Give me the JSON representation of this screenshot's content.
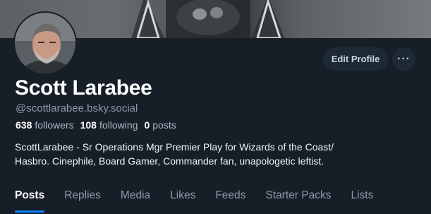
{
  "profile": {
    "display_name": "Scott Larabee",
    "handle": "@scottlarabee.bsky.social",
    "followers_count": "638",
    "followers_label": "followers",
    "following_count": "108",
    "following_label": "following",
    "posts_count": "0",
    "posts_label": "posts",
    "bio_line1": "ScottLarabee - Sr Operations Mgr Premier Play for Wizards of the Coast/",
    "bio_line2": "Hasbro. Cinephile, Board Gamer, Commander fan, unapologetic leftist."
  },
  "actions": {
    "edit_label": "Edit Profile",
    "more_label": "···"
  },
  "tabs": [
    {
      "label": "Posts",
      "active": true
    },
    {
      "label": "Replies",
      "active": false
    },
    {
      "label": "Media",
      "active": false
    },
    {
      "label": "Likes",
      "active": false
    },
    {
      "label": "Feeds",
      "active": false
    },
    {
      "label": "Starter Packs",
      "active": false
    },
    {
      "label": "Lists",
      "active": false
    }
  ],
  "colors": {
    "background": "#161e27",
    "accent": "#1083fe",
    "muted_text": "#8f9aa7",
    "button_bg": "#1e2936"
  },
  "icons": {
    "more": "ellipsis-icon"
  }
}
